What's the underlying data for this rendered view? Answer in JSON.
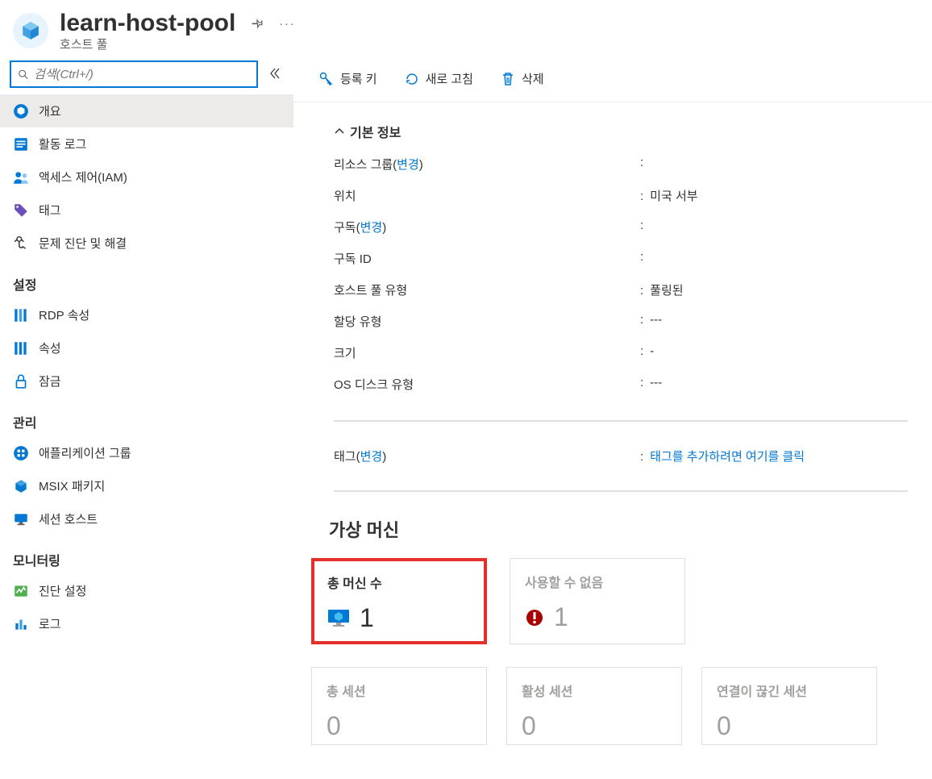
{
  "header": {
    "title": "learn-host-pool",
    "subtitle": "호스트 풀"
  },
  "search": {
    "placeholder": "검색(Ctrl+/)"
  },
  "sidebar": {
    "items": [
      {
        "label": "개요",
        "icon": "cube",
        "active": true
      },
      {
        "label": "활동 로그",
        "icon": "log",
        "active": false
      },
      {
        "label": "액세스 제어(IAM)",
        "icon": "iam",
        "active": false
      },
      {
        "label": "태그",
        "icon": "tag",
        "active": false
      },
      {
        "label": "문제 진단 및 해결",
        "icon": "diagnose",
        "active": false
      }
    ],
    "section1": "설정",
    "settings": [
      {
        "label": "RDP 속성",
        "icon": "rdp"
      },
      {
        "label": "속성",
        "icon": "props"
      },
      {
        "label": "잠금",
        "icon": "lock"
      }
    ],
    "section2": "관리",
    "manage": [
      {
        "label": "애플리케이션 그룹",
        "icon": "appgroup"
      },
      {
        "label": "MSIX 패키지",
        "icon": "msix"
      },
      {
        "label": "세션 호스트",
        "icon": "session"
      }
    ],
    "section3": "모니터링",
    "monitor": [
      {
        "label": "진단 설정",
        "icon": "diag"
      },
      {
        "label": "로그",
        "icon": "logs"
      }
    ]
  },
  "toolbar": {
    "regkey": "등록 키",
    "refresh": "새로 고침",
    "delete": "삭제"
  },
  "essentials": {
    "header": "기본 정보",
    "rows": [
      {
        "label": "리소스 그룹",
        "change": "변경",
        "value": ""
      },
      {
        "label": "위치",
        "change": "",
        "value": "미국 서부"
      },
      {
        "label": "구독",
        "change": "변경",
        "value": ""
      },
      {
        "label": "구독 ID",
        "change": "",
        "value": ""
      },
      {
        "label": "호스트 풀 유형",
        "change": "",
        "value": "풀링된"
      },
      {
        "label": "할당 유형",
        "change": "",
        "value": "---"
      },
      {
        "label": "크기",
        "change": "",
        "value": "-"
      },
      {
        "label": "OS 디스크 유형",
        "change": "",
        "value": "---"
      },
      {
        "label": "태그",
        "change": "변경",
        "value": "태그를 추가하려면 여기를 클릭",
        "link": true
      }
    ]
  },
  "vm": {
    "title": "가상 머신",
    "tiles": [
      {
        "title": "총 머신 수",
        "value": "1",
        "icon": "vm",
        "highlighted": true
      },
      {
        "title": "사용할 수 없음",
        "value": "1",
        "icon": "warn",
        "disabled": true
      }
    ],
    "tiles2": [
      {
        "title": "총 세션",
        "value": "0"
      },
      {
        "title": "활성 세션",
        "value": "0"
      },
      {
        "title": "연결이 끊긴 세션",
        "value": "0"
      }
    ]
  }
}
